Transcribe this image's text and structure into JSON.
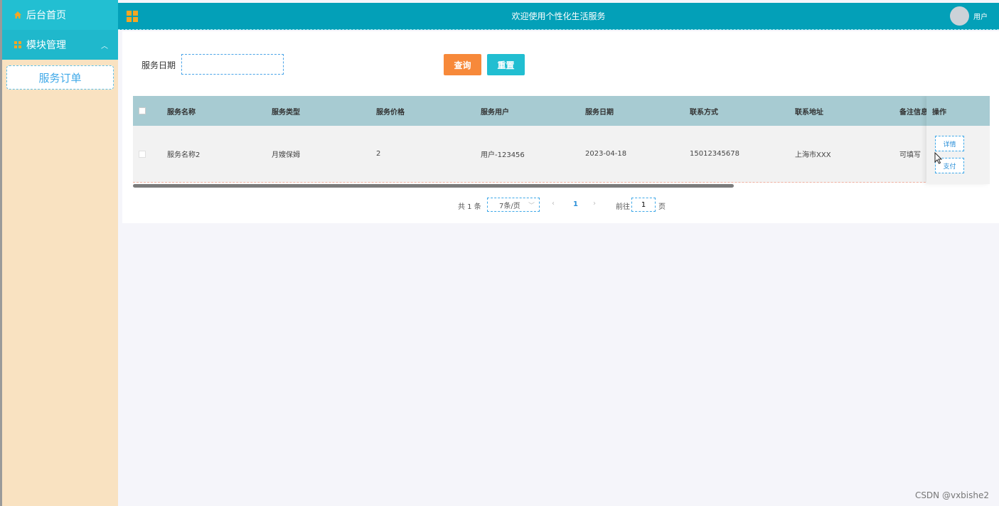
{
  "sidebar": {
    "home_label": "后台首页",
    "module_label": "模块管理",
    "sub_item": "服务订单"
  },
  "header": {
    "title": "欢迎使用个性化生活服务",
    "user_label": "用户"
  },
  "search": {
    "date_label": "服务日期",
    "date_value": "",
    "query_label": "查询",
    "reset_label": "重置"
  },
  "table": {
    "columns": [
      "服务名称",
      "服务类型",
      "服务价格",
      "服务用户",
      "服务日期",
      "联系方式",
      "联系地址",
      "备注信息",
      "操作"
    ],
    "rows": [
      {
        "name": "服务名称2",
        "type": "月嫂保姆",
        "price": "2",
        "user": "用户-123456",
        "date": "2023-04-18",
        "phone": "15012345678",
        "address": "上海市XXX",
        "remark": "可填写",
        "detail_label": "详情",
        "pay_label": "支付"
      }
    ]
  },
  "pager": {
    "total": "共 1 条",
    "page_size": "7条/页",
    "current_page": "1",
    "goto_prefix": "前往",
    "goto_value": "1",
    "goto_suffix": "页"
  },
  "watermark": "CSDN @vxbishe2",
  "colors": {
    "header": "#03a0b8",
    "sidebar_bg": "#f9e2c1",
    "sidebar_item": "#1fb8cc",
    "query_btn": "#f7893a",
    "reset_btn": "#21bed1",
    "table_head": "#a7cbd2"
  }
}
